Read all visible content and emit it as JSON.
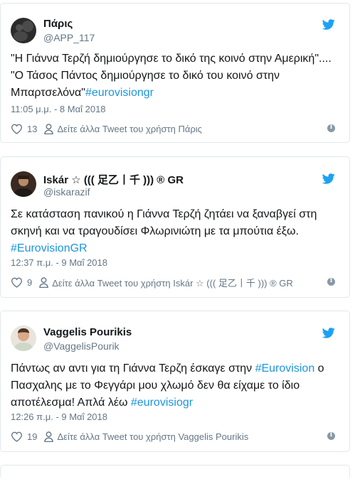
{
  "colors": {
    "link": "#1b95e0",
    "muted": "#657786",
    "twitter_blue": "#1da1f2",
    "border": "#e1e8ed"
  },
  "tweets": [
    {
      "name": "Πάρις",
      "handle": "@APP_117",
      "avatar_icon": "avatar-smoke",
      "text_parts": [
        {
          "text": "\"Η Γιάννα Τερζή δημιούργησε το δικό της κοινό στην Αμερική\"....",
          "tag": false
        },
        {
          "text": "\"Ο Τάσος Πάντος δημιούργησε το δικό του κοινό στην Μπαρτσελόνα\"",
          "tag": false
        },
        {
          "text": "#eurovisiongr",
          "tag": true
        }
      ],
      "time": "11:05 μ.μ. - 8 Μαΐ 2018",
      "likes": "13",
      "more_label": "Δείτε άλλα Tweet του χρήστη Πάρις"
    },
    {
      "name": "Iskár ☆ ((( ⾜乙丨千 ))) ® GR",
      "handle": "@iskarazif",
      "avatar_icon": "avatar-person-dark",
      "text_parts": [
        {
          "text": "Σε κατάσταση πανικού η Γιάννα Τερζή ζητάει να ξαναβγεί στη σκηνή και να τραγουδίσει Φλωρινιώτη με τα μπούτια έξω. ",
          "tag": false
        },
        {
          "text": "#EurovisionGR",
          "tag": true
        }
      ],
      "time": "12:37 π.μ. - 9 Μαΐ 2018",
      "likes": "9",
      "more_label": "Δείτε άλλα Tweet του χρήστη Iskár ☆ ((( ⾜乙丨千 ))) ® GR"
    },
    {
      "name": "Vaggelis Pourikis",
      "handle": "@VaggelisPourik",
      "avatar_icon": "avatar-person-light",
      "text_parts": [
        {
          "text": "Πάντως αν αντι για τη Γιάννα Τερζη έσκαγε στην ",
          "tag": false
        },
        {
          "text": "#Eurovision",
          "tag": true
        },
        {
          "text": " ο Πασχαλης με το Φεγγάρι μου χλωμό δεν θα είχαμε το ίδιο αποτέλεσμα! Απλά λέω ",
          "tag": false
        },
        {
          "text": "#eurovisiogr",
          "tag": true
        }
      ],
      "time": "12:26 π.μ. - 9 Μαΐ 2018",
      "likes": "19",
      "more_label": "Δείτε άλλα Tweet του χρήστη Vaggelis Pourikis"
    }
  ]
}
